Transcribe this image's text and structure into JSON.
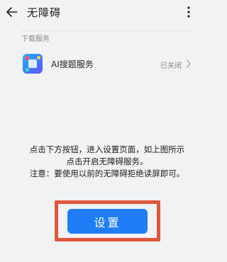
{
  "header": {
    "title": "无障碍",
    "back_icon": "arrow-left-icon",
    "more_icon": "more-vertical-icon"
  },
  "downloaded_services": {
    "section_label": "下载服务",
    "items": [
      {
        "name": "AI搜题服务",
        "status": "已关闭",
        "icon": "app-icon"
      }
    ]
  },
  "instructions": {
    "line1": "点击下方按钮，进入设置页面，如上图所示",
    "line2": "点击开启无障碍服务。",
    "line3": "注意：要使用以前的无障碍拒绝读屏即可。"
  },
  "setup_button": {
    "label": "设置"
  },
  "colors": {
    "accent": "#1f7ef5",
    "highlight": "#e0563a",
    "background": "#f1f2f4"
  }
}
